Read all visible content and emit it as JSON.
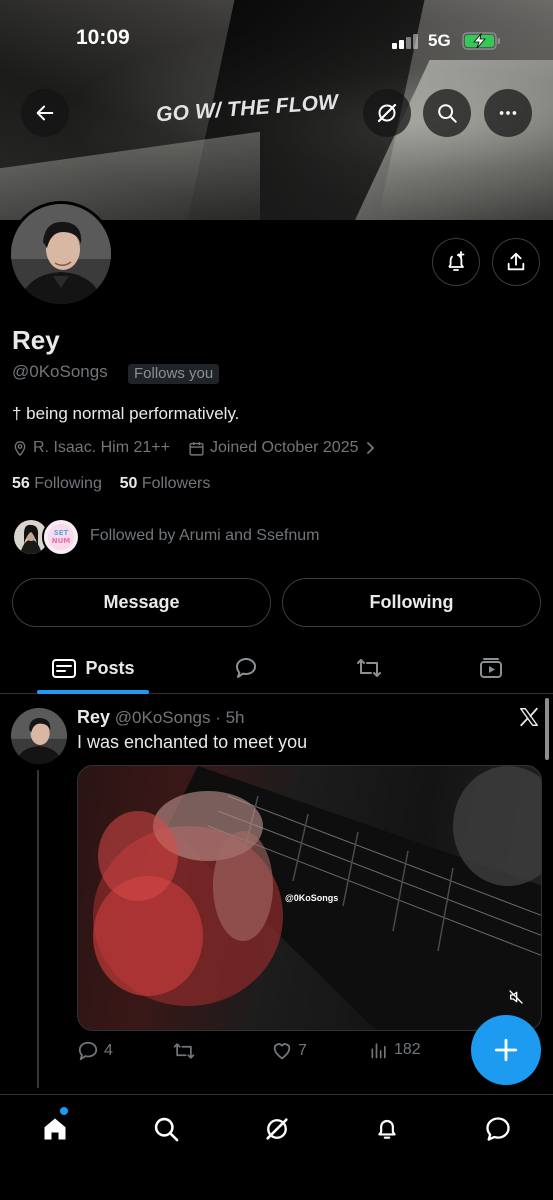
{
  "status_bar": {
    "time": "10:09",
    "network": "5G"
  },
  "banner": {
    "text": "GO W/ THE FLOW"
  },
  "profile": {
    "name": "Rey",
    "handle": "@0KoSongs",
    "follows_you": "Follows you",
    "bio": "† being normal performatively.",
    "location": "R. Isaac. Him 21++",
    "joined": "Joined October 2025",
    "following_count": "56",
    "following_label": "Following",
    "followers_count": "50",
    "followers_label": "Followers",
    "followed_by": "Followed by Arumi and Ssefnum"
  },
  "buttons": {
    "message": "Message",
    "following": "Following"
  },
  "tabs": {
    "posts": "Posts"
  },
  "post": {
    "author": "Rey",
    "handle_time": "@0KoSongs · 5h",
    "text": "I was enchanted to meet you",
    "watermark": "@0KoSongs",
    "replies": "4",
    "likes": "7",
    "views": "182"
  },
  "colors": {
    "accent": "#1d9bf0",
    "background": "#000000",
    "muted": "#71767b"
  }
}
